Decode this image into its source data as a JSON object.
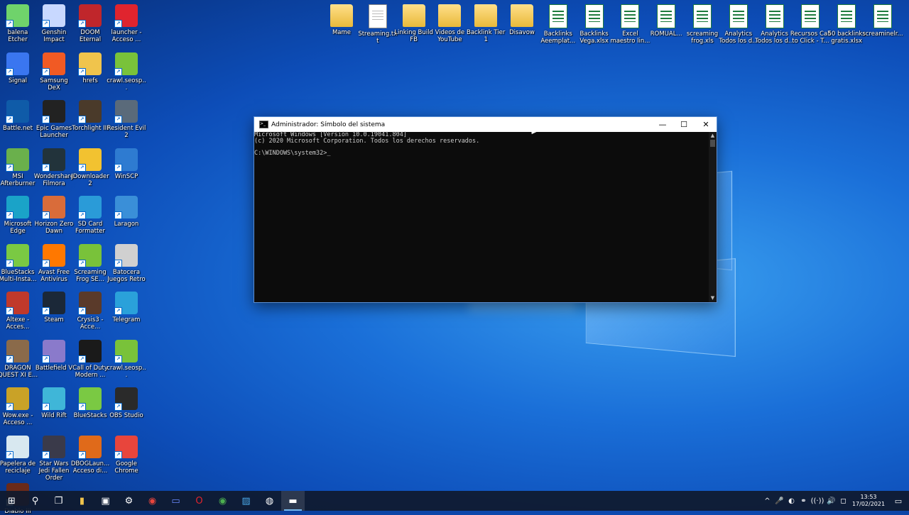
{
  "desktop": {
    "left_icons": [
      {
        "label": "balena Etcher",
        "icon": "cube-icon",
        "color": "#6fd36b"
      },
      {
        "label": "Genshin Impact",
        "icon": "character-icon",
        "color": "#c8d8ff"
      },
      {
        "label": "DOOM Eternal",
        "icon": "doom-icon",
        "color": "#c0262b"
      },
      {
        "label": "launcher - Acceso ...",
        "icon": "opera-icon",
        "color": "#e0242e"
      },
      {
        "label": "Signal",
        "icon": "signal-icon",
        "color": "#3a76f0"
      },
      {
        "label": "Samsung DeX",
        "icon": "dex-icon",
        "color": "#f15a24"
      },
      {
        "label": "hrefs",
        "icon": "folder-icon",
        "color": "#f0c44c"
      },
      {
        "label": "crawl.seosp...",
        "icon": "frog-icon",
        "color": "#79c23a"
      },
      {
        "label": "Battle.net",
        "icon": "battlenet-icon",
        "color": "#0f5ba8"
      },
      {
        "label": "Epic Games Launcher",
        "icon": "epic-icon",
        "color": "#222222"
      },
      {
        "label": "Torchlight III",
        "icon": "torchlight-icon",
        "color": "#4a3a2a"
      },
      {
        "label": "Resident Evil 2",
        "icon": "re2-icon",
        "color": "#5a6a7a"
      },
      {
        "label": "MSI Afterburner",
        "icon": "msi-icon",
        "color": "#6ab04c"
      },
      {
        "label": "Wondershare Filmora",
        "icon": "filmora-icon",
        "color": "#22333b"
      },
      {
        "label": "JDownloader 2",
        "icon": "jdownloader-icon",
        "color": "#f2c230"
      },
      {
        "label": "WinSCP",
        "icon": "winscp-icon",
        "color": "#2e7bd1"
      },
      {
        "label": "Microsoft Edge",
        "icon": "edge-icon",
        "color": "#1aa3c8"
      },
      {
        "label": "Horizon Zero Dawn",
        "icon": "horizon-icon",
        "color": "#d96c3a"
      },
      {
        "label": "SD Card Formatter",
        "icon": "sdcard-icon",
        "color": "#2a9bd8"
      },
      {
        "label": "Laragon",
        "icon": "laragon-icon",
        "color": "#3a8fd8"
      },
      {
        "label": "BlueStacks Multi-Insta...",
        "icon": "bluestacks-icon",
        "color": "#7ac943"
      },
      {
        "label": "Avast Free Antivirus",
        "icon": "avast-icon",
        "color": "#ff7800"
      },
      {
        "label": "Screaming Frog SE...",
        "icon": "frog-icon",
        "color": "#79c23a"
      },
      {
        "label": "Batocera Juegos Retro",
        "icon": "drive-icon",
        "color": "#d0d0d0"
      },
      {
        "label": "Altexe - Acces...",
        "icon": "game-icon",
        "color": "#c0392b"
      },
      {
        "label": "Steam",
        "icon": "steam-icon",
        "color": "#1b2838"
      },
      {
        "label": "Crysis3 - Acce...",
        "icon": "crysis-icon",
        "color": "#5a3a2a"
      },
      {
        "label": "Telegram",
        "icon": "telegram-icon",
        "color": "#2aa1da"
      },
      {
        "label": "DRAGON QUEST XI E...",
        "icon": "dq-icon",
        "color": "#8a6a4a"
      },
      {
        "label": "Battlefield V",
        "icon": "battlefield-icon",
        "color": "#8a7acb"
      },
      {
        "label": "Call of Duty Modern ...",
        "icon": "cod-icon",
        "color": "#1a1a1a"
      },
      {
        "label": "crawl.seosp...",
        "icon": "frog-icon",
        "color": "#79c23a"
      },
      {
        "label": "Wow.exe - Acceso ...",
        "icon": "wow-icon",
        "color": "#c9a227"
      },
      {
        "label": "Wild Rift",
        "icon": "wildrift-icon",
        "color": "#3fb6d8"
      },
      {
        "label": "BlueStacks",
        "icon": "bluestacks-icon",
        "color": "#7ac943"
      },
      {
        "label": "OBS Studio",
        "icon": "obs-icon",
        "color": "#2a2a2a"
      },
      {
        "label": "Papelera de reciclaje",
        "icon": "recycle-bin-icon",
        "color": "#d8e8f0"
      },
      {
        "label": "Star Wars Jedi Fallen Order",
        "icon": "starwars-icon",
        "color": "#3a3a4a"
      },
      {
        "label": "DBOGLaun... Acceso di...",
        "icon": "dbo-icon",
        "color": "#e06a1a"
      },
      {
        "label": "Google Chrome",
        "icon": "chrome-icon",
        "color": "#e8453c"
      },
      {
        "label": "Diablo III",
        "icon": "diablo-icon",
        "color": "#6a2a1a"
      }
    ],
    "top_icons": [
      {
        "label": "Mame",
        "type": "folder"
      },
      {
        "label": "Streaming.txt",
        "type": "doc"
      },
      {
        "label": "Linking Build FB",
        "type": "folder"
      },
      {
        "label": "Videos de YouTube",
        "type": "folder"
      },
      {
        "label": "Backlink Tier 1",
        "type": "folder"
      },
      {
        "label": "Disavow",
        "type": "folder"
      },
      {
        "label": "Backlinks Aeemplat...",
        "type": "sheet"
      },
      {
        "label": "Backlinks Vega.xlsx",
        "type": "sheet"
      },
      {
        "label": "Excel maestro lin...",
        "type": "sheet"
      },
      {
        "label": "ROMUAL...",
        "type": "sheet"
      },
      {
        "label": "screaming frog.xls",
        "type": "sheet"
      },
      {
        "label": "Analytics Todos los d...",
        "type": "sheet"
      },
      {
        "label": "Analytics Todos los d...",
        "type": "sheet"
      },
      {
        "label": "Recursos Call to Click - T...",
        "type": "sheet"
      },
      {
        "label": "50 backlinks gratis.xlsx",
        "type": "sheet"
      },
      {
        "label": "screaminelr...",
        "type": "sheet"
      }
    ]
  },
  "cmd": {
    "title": "Administrador: Símbolo del sistema",
    "minimize": "—",
    "maximize": "☐",
    "close": "✕",
    "lines": "Microsoft Windows [Versión 10.0.19041.804]\n(c) 2020 Microsoft Corporation. Todos los derechos reservados.\n\nC:\\WINDOWS\\system32>_"
  },
  "taskbar": {
    "apps": [
      {
        "name": "start-button",
        "glyph": "⊞"
      },
      {
        "name": "search-icon",
        "glyph": "⚲"
      },
      {
        "name": "task-view-icon",
        "glyph": "❐"
      },
      {
        "name": "file-explorer-icon",
        "glyph": "▮",
        "color": "#f0c44c"
      },
      {
        "name": "store-icon",
        "glyph": "▣"
      },
      {
        "name": "settings-icon",
        "glyph": "⚙"
      },
      {
        "name": "chrome-icon",
        "glyph": "◉",
        "color": "#e8453c"
      },
      {
        "name": "remote-icon",
        "glyph": "▭",
        "color": "#6a8aff"
      },
      {
        "name": "opera-icon",
        "glyph": "O",
        "color": "#e0242e"
      },
      {
        "name": "chrome-alt-icon",
        "glyph": "◉",
        "color": "#4caf50"
      },
      {
        "name": "photos-icon",
        "glyph": "▨",
        "color": "#4aa8e8"
      },
      {
        "name": "obs-icon",
        "glyph": "◍"
      },
      {
        "name": "cmd-icon",
        "glyph": "▬",
        "active": true
      }
    ],
    "tray": {
      "chevron": "^",
      "mic": "🎤",
      "net1": "◐",
      "net2": "⚭",
      "wifi": "((·))",
      "speaker": "🔊",
      "lang": "◻",
      "time": "13:53",
      "date": "17/02/2021",
      "notifications": "▭"
    }
  }
}
